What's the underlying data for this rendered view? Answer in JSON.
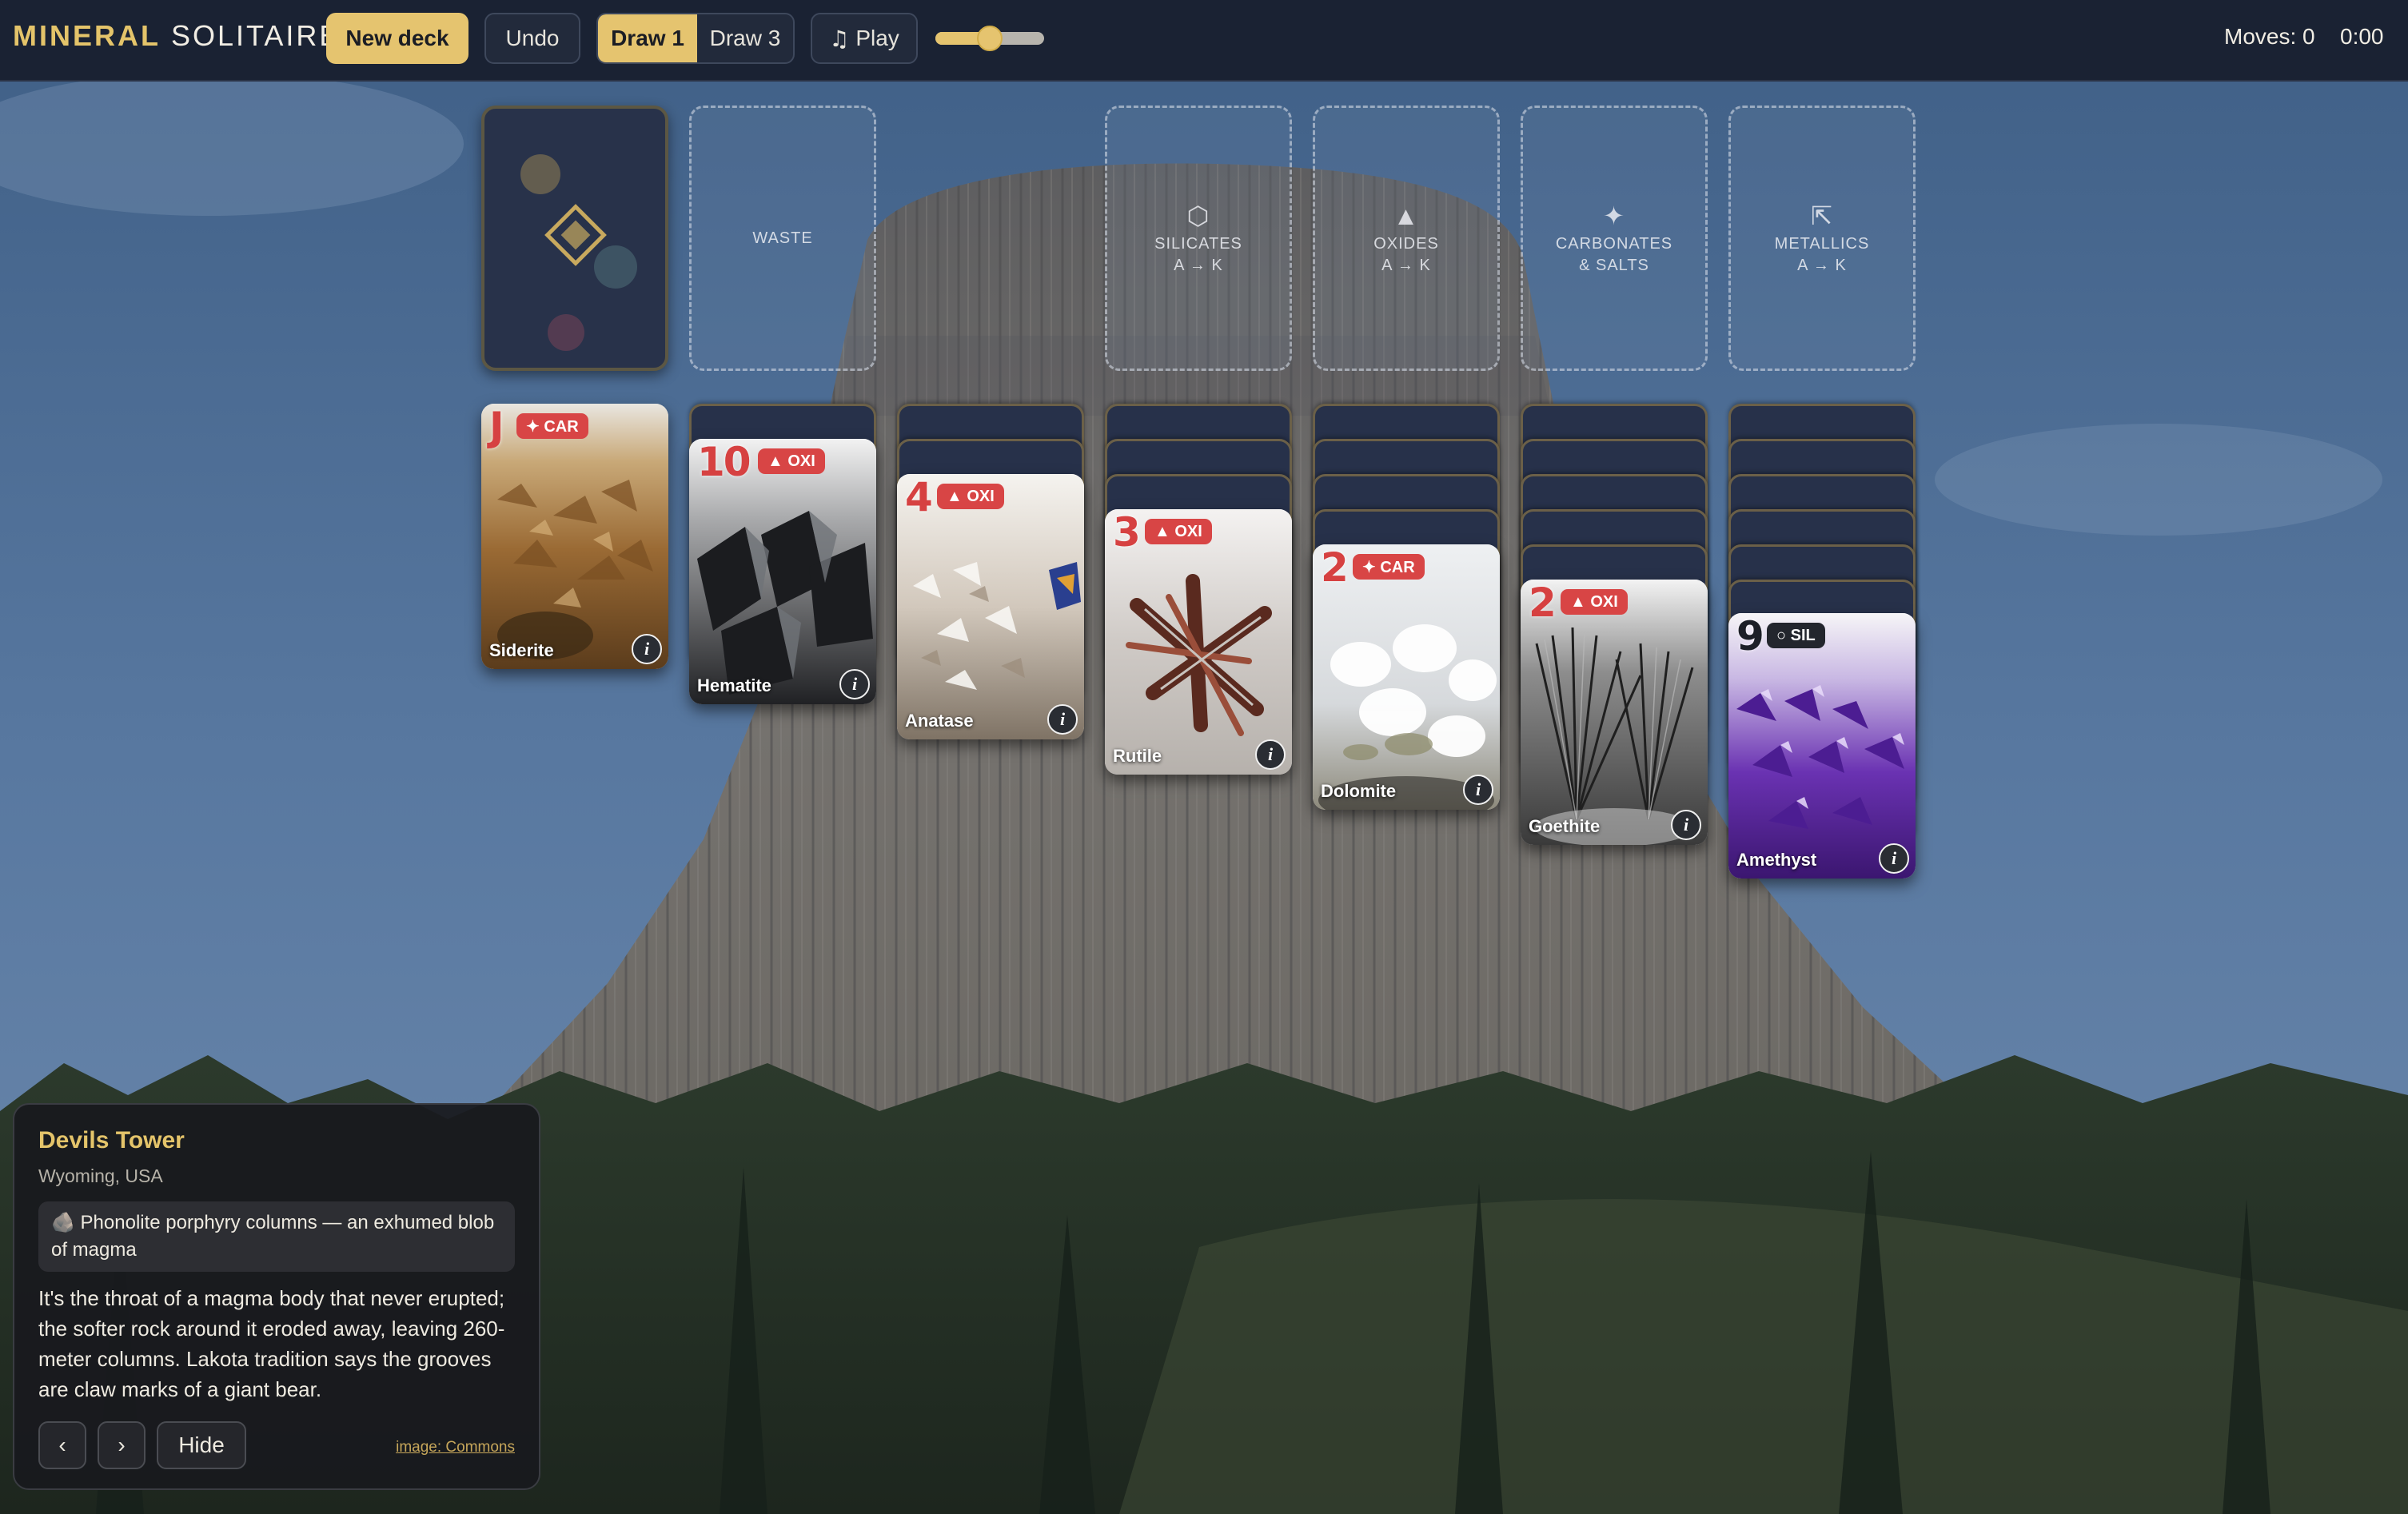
{
  "app": {
    "title_part1": "MINERAL",
    "title_part2": " SOLITAIRE",
    "accent_color": "#e5c46f"
  },
  "toolbar": {
    "new_deck": "New deck",
    "undo": "Undo",
    "draw1": "Draw 1",
    "draw3": "Draw 3",
    "draw_selected": "Draw 1",
    "play": "Play",
    "play_icon": "music-note-icon",
    "volume": 0.5,
    "moves": "Moves: 0",
    "timer": "0:00"
  },
  "slots": {
    "waste": "WASTE",
    "foundations": [
      {
        "icon": "⬡",
        "line1": "SILICATES",
        "line2": "A → K"
      },
      {
        "icon": "▲",
        "line1": "OXIDES",
        "line2": "A → K"
      },
      {
        "icon": "✦",
        "line1": "CARBONATES",
        "line2": "& SALTS"
      },
      {
        "icon": "⇱",
        "line1": "METALLICS",
        "line2": "A → K"
      }
    ]
  },
  "tableau": [
    {
      "hidden": 0,
      "rank": "J",
      "tag": "✦ CAR",
      "color": "red",
      "name": "Siderite"
    },
    {
      "hidden": 1,
      "rank": "10",
      "tag": "▲ OXI",
      "color": "red",
      "name": "Hematite"
    },
    {
      "hidden": 2,
      "rank": "4",
      "tag": "▲ OXI",
      "color": "red",
      "name": "Anatase"
    },
    {
      "hidden": 3,
      "rank": "3",
      "tag": "▲ OXI",
      "color": "red",
      "name": "Rutile"
    },
    {
      "hidden": 4,
      "rank": "2",
      "tag": "✦ CAR",
      "color": "red",
      "name": "Dolomite"
    },
    {
      "hidden": 5,
      "rank": "2",
      "tag": "▲ OXI",
      "color": "red",
      "name": "Goethite"
    },
    {
      "hidden": 6,
      "rank": "9",
      "tag": "○ SIL",
      "color": "black",
      "name": "Amethyst"
    }
  ],
  "info_button": "i",
  "panel": {
    "title": "Devils Tower",
    "location": "Wyoming, USA",
    "note": "🪨 Phonolite porphyry columns — an exhumed blob of magma",
    "body": "It's the throat of a magma body that never erupted; the softer rock around it eroded away, leaving 260-meter columns. Lakota tradition says the grooves are claw marks of a giant bear.",
    "prev": "‹",
    "next": "›",
    "hide": "Hide",
    "credit": "image: Commons"
  }
}
